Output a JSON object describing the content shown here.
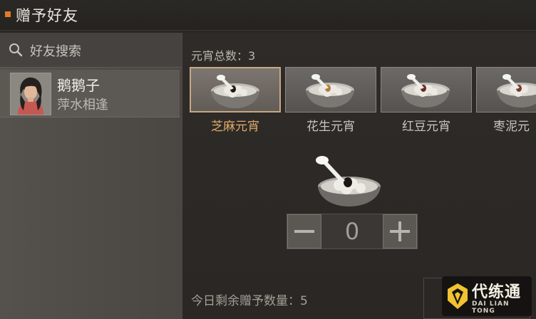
{
  "header": {
    "title": "赠予好友",
    "accent": "#e07a2c"
  },
  "search": {
    "placeholder": "好友搜索",
    "icon": "search-icon"
  },
  "friends": [
    {
      "name": "鹅鹅子",
      "tag": "萍水相逢",
      "avatar": "avatar-woman"
    }
  ],
  "gift": {
    "total_label": "元宵总数：3",
    "items": [
      {
        "label": "芝麻元宵",
        "filling": "#1c1512",
        "selected": true
      },
      {
        "label": "花生元宵",
        "filling": "#b87a3a",
        "selected": false
      },
      {
        "label": "红豆元宵",
        "filling": "#6b2a22",
        "selected": false
      },
      {
        "label": "枣泥元",
        "filling": "#7a3a2c",
        "selected": false
      }
    ],
    "quantity": "0",
    "minus_icon": "minus-icon",
    "plus_icon": "plus-icon",
    "remaining_label": "今日剩余赠予数量：5"
  },
  "watermark": {
    "cn": "代练通",
    "en": "DAI LIAN TONG"
  },
  "colors": {
    "selected_border": "#c7a784",
    "selected_label": "#e0a96a"
  }
}
